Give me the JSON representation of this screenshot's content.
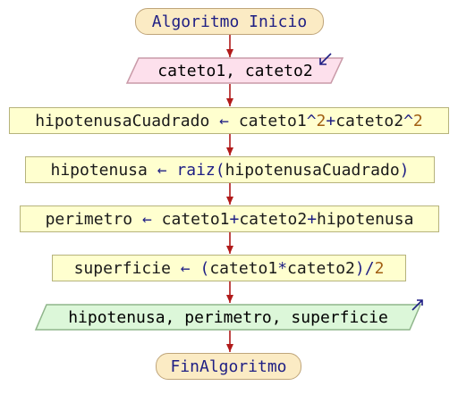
{
  "flowchart": {
    "start": "Algoritmo Inicio",
    "read": {
      "text": "cateto1, cateto2"
    },
    "step1": {
      "target": "hipotenusaCuadrado",
      "arrow": "←",
      "a": "cateto1",
      "p1": "^",
      "n1": "2",
      "plus": "+",
      "b": "cateto2",
      "p2": "^",
      "n2": "2"
    },
    "step2": {
      "target": "hipotenusa",
      "arrow": "←",
      "fn": "raiz",
      "open": "(",
      "arg": "hipotenusaCuadrado",
      "close": ")"
    },
    "step3": {
      "target": "perimetro",
      "arrow": "←",
      "a": "cateto1",
      "plus1": "+",
      "b": "cateto2",
      "plus2": "+",
      "c": "hipotenusa"
    },
    "step4": {
      "target": "superficie",
      "arrow": "←",
      "open": "(",
      "a": "cateto1",
      "times": "*",
      "b": "cateto2",
      "close": ")",
      "div": "/",
      "n": "2"
    },
    "write": {
      "text": "hipotenusa, perimetro, superficie"
    },
    "end": "FinAlgoritmo"
  },
  "colors": {
    "terminal_fill": "#fbebc4",
    "read_fill": "#fde0ec",
    "process_fill": "#ffffcf",
    "write_fill": "#dcf7d9",
    "arrow": "#b11a1a",
    "keyword": "#1e1e84",
    "number": "#a15f12"
  }
}
